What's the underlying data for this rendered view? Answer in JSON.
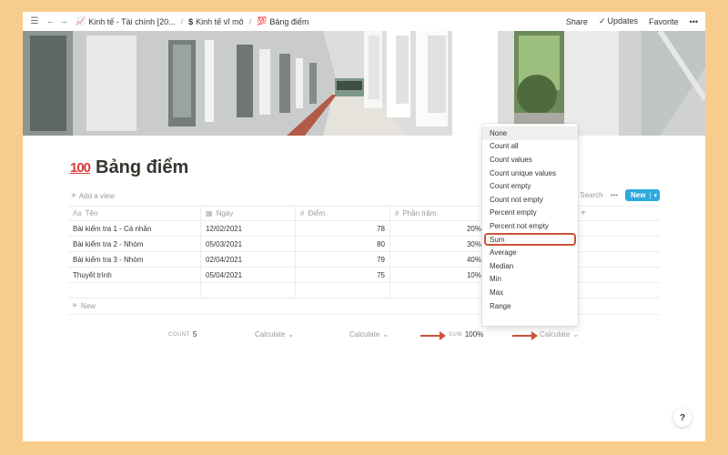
{
  "breadcrumb": [
    {
      "emoji": "📈",
      "label": "Kinh tế - Tài chính [20..."
    },
    {
      "emoji": "$",
      "label": "Kinh tế vĩ mô"
    },
    {
      "emoji": "💯",
      "label": "Bảng điểm"
    }
  ],
  "topbar": {
    "share": "Share",
    "updates": "Updates",
    "favorite": "Favorite",
    "more": "•••"
  },
  "page": {
    "emoji": "100",
    "title": "Bảng điểm",
    "add_view": "Add a view"
  },
  "toolbar": {
    "search": "Search",
    "more": "•••",
    "new": "New"
  },
  "table": {
    "columns": [
      {
        "icon": "Aa",
        "label": "Tên"
      },
      {
        "icon": "▦",
        "label": "Ngày"
      },
      {
        "icon": "#",
        "label": "Điểm"
      },
      {
        "icon": "#",
        "label": "Phần trăm"
      }
    ],
    "rows": [
      {
        "name": "Bài kiểm tra 1 - Cá nhân",
        "date": "12/02/2021",
        "score": "78",
        "percent": "20%"
      },
      {
        "name": "Bài kiểm tra 2 - Nhóm",
        "date": "05/03/2021",
        "score": "80",
        "percent": "30%"
      },
      {
        "name": "Bài kiểm tra 3 - Nhóm",
        "date": "02/04/2021",
        "score": "79",
        "percent": "40%"
      },
      {
        "name": "Thuyết trình",
        "date": "05/04/2021",
        "score": "75",
        "percent": "10%"
      }
    ],
    "new_row": "New"
  },
  "calc": {
    "count_label": "COUNT",
    "count_value": "5",
    "date_calc": "Calculate",
    "score_calc": "Calculate",
    "sum_label": "SUM",
    "sum_value": "100%",
    "extra_calc": "Calculate"
  },
  "dropdown": {
    "options": [
      "None",
      "Count all",
      "Count values",
      "Count unique values",
      "Count empty",
      "Count not empty",
      "Percent empty",
      "Percent not empty",
      "Sum",
      "Average",
      "Median",
      "Min",
      "Max",
      "Range"
    ]
  },
  "help": "?",
  "colors": {
    "accent": "#2eaadc",
    "highlight": "#c9533a",
    "background": "#f8cd8c"
  }
}
